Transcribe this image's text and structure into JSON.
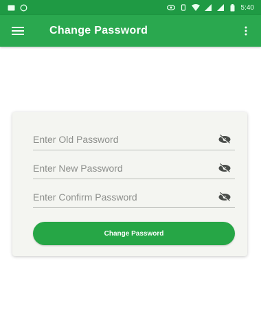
{
  "status_bar": {
    "time": "5:40",
    "icons": [
      "message-icon",
      "whatsapp-icon",
      "eye-icon",
      "vibrate-icon",
      "wifi-icon",
      "signal-icon",
      "signal-icon",
      "battery-icon"
    ]
  },
  "app_bar": {
    "title": "Change Password",
    "menu_icon": "hamburger-icon",
    "overflow_icon": "more-vert-icon"
  },
  "form": {
    "old_password_placeholder": "Enter Old Password",
    "new_password_placeholder": "Enter New Password",
    "confirm_password_placeholder": "Enter Confirm Password",
    "visibility_icon": "visibility-off-icon",
    "submit_label": "Change Password"
  },
  "colors": {
    "primary": "#2aa84f",
    "status_bar": "#1f9a44",
    "button": "#26a646",
    "card_bg": "#f4f5f1"
  }
}
